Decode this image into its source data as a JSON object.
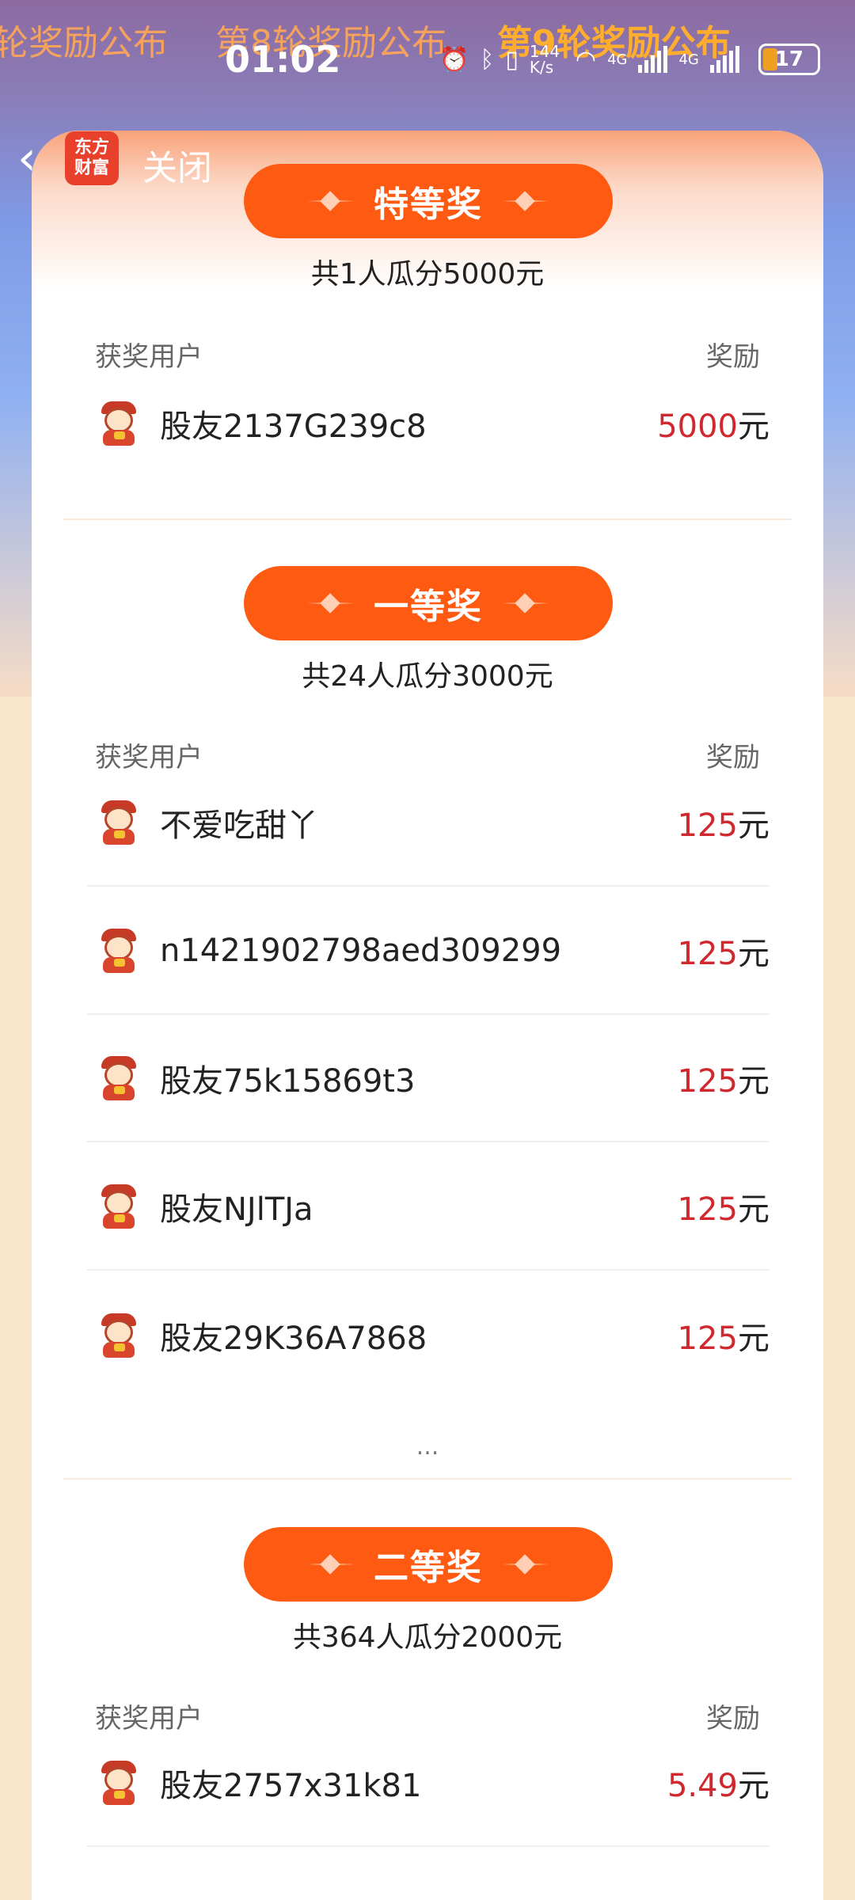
{
  "rounds_ticker": [
    {
      "label": "轮奖励公布",
      "active": false
    },
    {
      "label": "第8轮奖励公布",
      "active": false
    },
    {
      "label": "第9轮奖励公布",
      "active": true
    }
  ],
  "status_bar": {
    "time": "01:02",
    "network_speed": "144 K/s",
    "signal_1": "4G",
    "signal_2": "4G",
    "battery": "17"
  },
  "header": {
    "back_icon": "chevron-left-icon",
    "app_logo_line1": "东方",
    "app_logo_line2": "财富",
    "close_label": "关闭"
  },
  "columns": {
    "user": "获奖用户",
    "reward": "奖励"
  },
  "ellipsis": "...",
  "prizes": [
    {
      "title": "特等奖",
      "summary": "共1人瓜分5000元",
      "winners": [
        {
          "name": "股友2137G239c8",
          "amount": "5000",
          "unit": "元"
        }
      ]
    },
    {
      "title": "一等奖",
      "summary": "共24人瓜分3000元",
      "winners": [
        {
          "name": "不爱吃甜丫",
          "amount": "125",
          "unit": "元"
        },
        {
          "name": "n1421902798aed309299",
          "amount": "125",
          "unit": "元"
        },
        {
          "name": "股友75k15869t3",
          "amount": "125",
          "unit": "元"
        },
        {
          "name": "股友NJlTJa",
          "amount": "125",
          "unit": "元"
        },
        {
          "name": "股友29K36A7868",
          "amount": "125",
          "unit": "元"
        }
      ]
    },
    {
      "title": "二等奖",
      "summary": "共364人瓜分2000元",
      "winners": [
        {
          "name": "股友2757x31k81",
          "amount": "5.49",
          "unit": "元"
        }
      ]
    }
  ]
}
